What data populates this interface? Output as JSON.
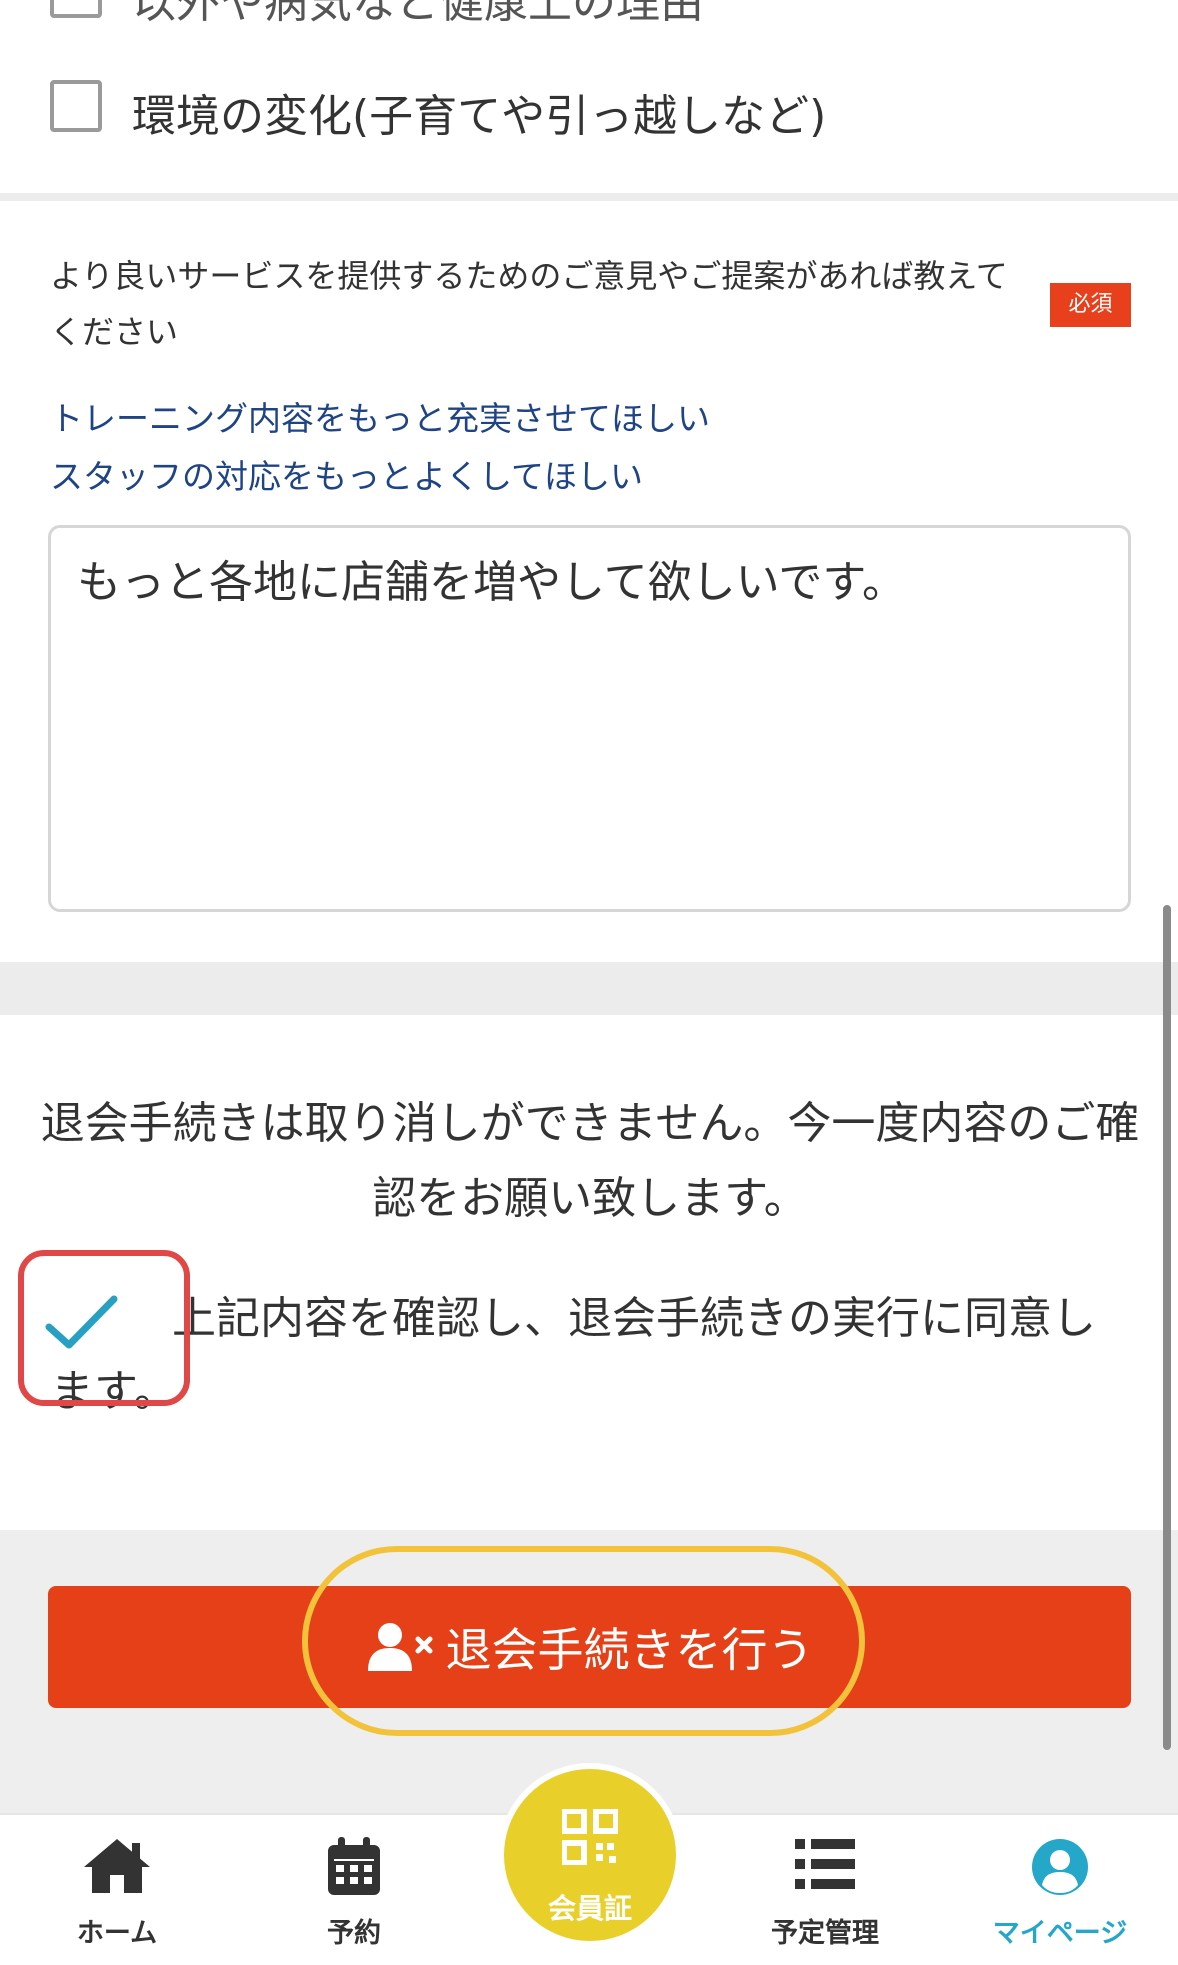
{
  "top_options": {
    "partial_label": "以外や病気など健康上の理由",
    "environment_label": "環境の変化(子育てや引っ越しなど)"
  },
  "feedback": {
    "question": "より良いサービスを提供するためのご意見やご提案があれば教えてください",
    "required_badge": "必須",
    "suggestions": [
      "トレーニング内容をもっと充実させてほしい",
      "スタッフの対応をもっとよくしてほしい"
    ],
    "text_value": "もっと各地に店舗を増やして欲しいです。"
  },
  "confirmation": {
    "notice": "退会手続きは取り消しができません。今一度内容のご確認をお願い致します。",
    "agree_label": "上記内容を確認し、退会手続きの実行に同意します。",
    "agree_checked": true
  },
  "action": {
    "withdraw_label": "退会手続きを行う",
    "icon": "user-remove-icon",
    "color": "#e54017"
  },
  "nav": {
    "items": [
      {
        "label": "ホーム",
        "icon": "home-icon"
      },
      {
        "label": "予約",
        "icon": "calendar-icon"
      },
      {
        "label": "会員証",
        "icon": "qr-code-icon"
      },
      {
        "label": "予定管理",
        "icon": "list-icon"
      },
      {
        "label": "マイページ",
        "icon": "user-circle-icon",
        "active": true
      }
    ],
    "active_color": "#24a7c9",
    "center_color": "#e9cf2a"
  }
}
